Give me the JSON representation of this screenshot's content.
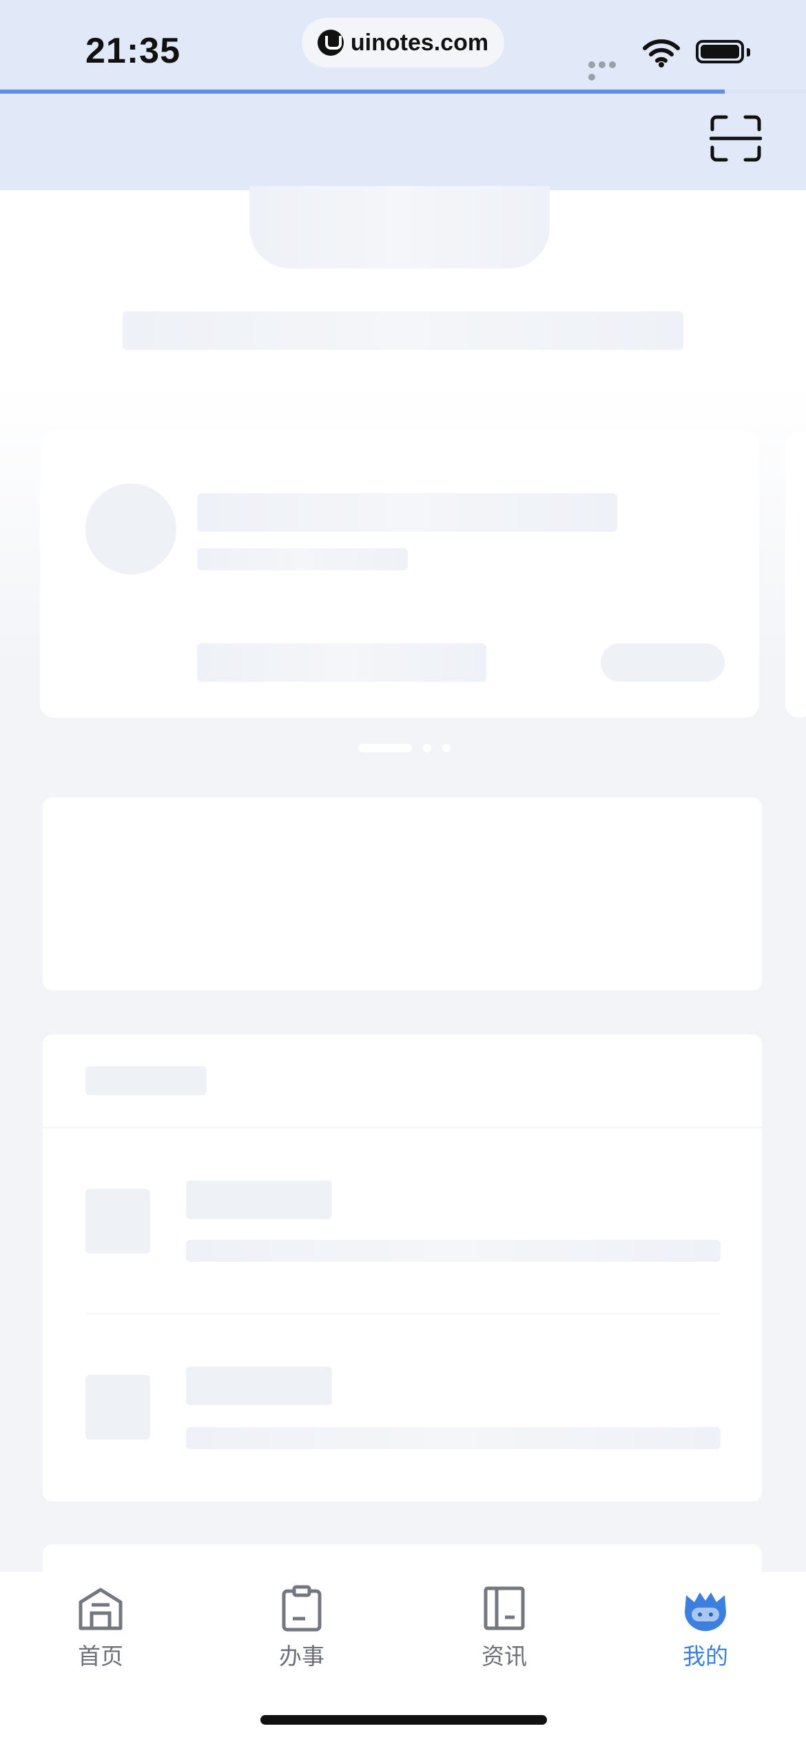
{
  "status_bar": {
    "time": "21:35",
    "url": "uinotes.com",
    "icons": [
      "signal-icon",
      "wifi-icon",
      "battery-icon"
    ]
  },
  "page_load_progress": 0.9,
  "header": {
    "scan_icon": "scan-icon"
  },
  "tab_bar": {
    "items": [
      {
        "label": "首页",
        "icon": "home-icon",
        "active": false
      },
      {
        "label": "办事",
        "icon": "clipboard-icon",
        "active": false
      },
      {
        "label": "资讯",
        "icon": "book-icon",
        "active": false
      },
      {
        "label": "我的",
        "icon": "avatar-icon",
        "active": true
      }
    ]
  },
  "carousel": {
    "pages": 3,
    "active_index": 0
  },
  "colors": {
    "header_bg": "#e1e9f8",
    "accent": "#3d7fe0",
    "progress": "#5f8ee6",
    "skeleton": "#eef1f6"
  }
}
